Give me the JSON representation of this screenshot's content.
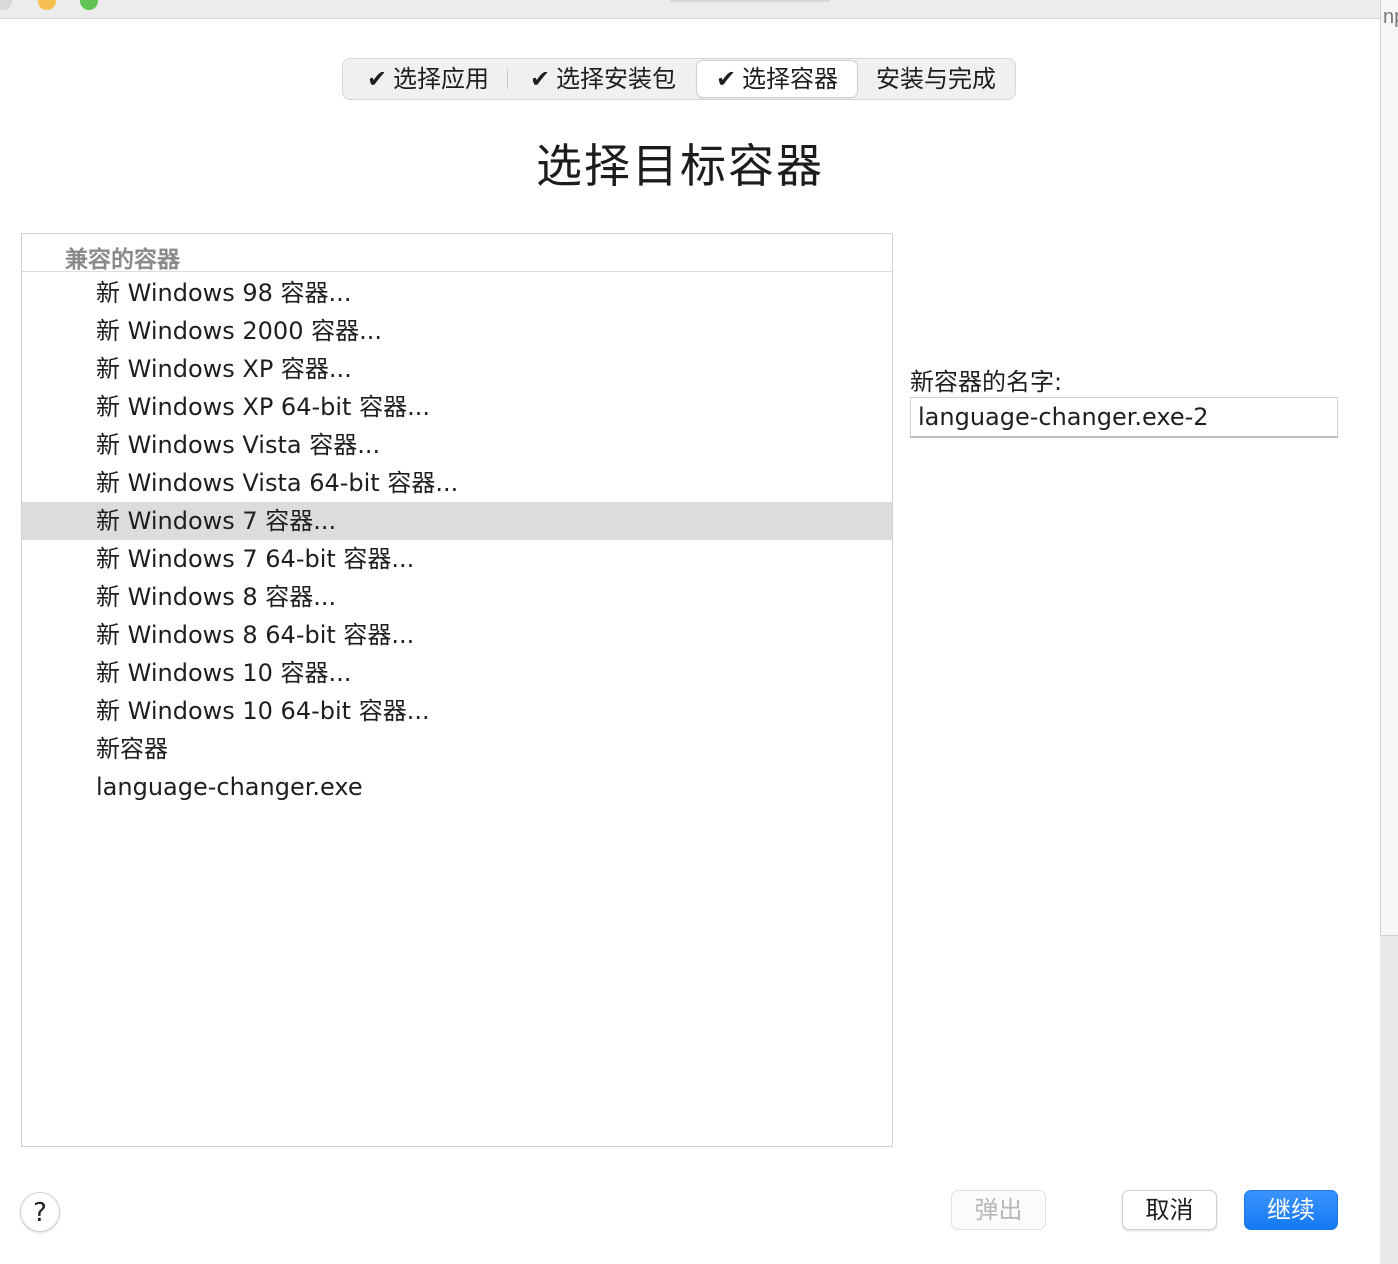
{
  "steps": [
    {
      "label": "选择应用",
      "done": true,
      "active": false
    },
    {
      "label": "选择安装包",
      "done": true,
      "active": false
    },
    {
      "label": "选择容器",
      "done": true,
      "active": true
    },
    {
      "label": "安装与完成",
      "done": false,
      "active": false
    }
  ],
  "check_glyph": "✔",
  "page": {
    "title": "选择目标容器"
  },
  "container_list": {
    "header": "兼容的容器",
    "selected_index": 6,
    "items": [
      "新 Windows 98 容器...",
      "新 Windows 2000 容器...",
      "新 Windows XP 容器...",
      "新 Windows XP 64-bit 容器...",
      "新 Windows Vista 容器...",
      "新 Windows Vista 64-bit 容器...",
      "新 Windows 7 容器...",
      "新 Windows 7 64-bit 容器...",
      "新 Windows 8 容器...",
      "新 Windows 8 64-bit 容器...",
      "新 Windows 10 容器...",
      "新 Windows 10 64-bit 容器...",
      "新容器",
      "language-changer.exe"
    ]
  },
  "new_name": {
    "label": "新容器的名字:",
    "value": "language-changer.exe-2"
  },
  "buttons": {
    "help": "?",
    "eject": "弹出",
    "cancel": "取消",
    "continue": "继续"
  },
  "background_window_text": "np",
  "colors": {
    "accent": "#1479f2",
    "selection": "#dcdcdc"
  }
}
